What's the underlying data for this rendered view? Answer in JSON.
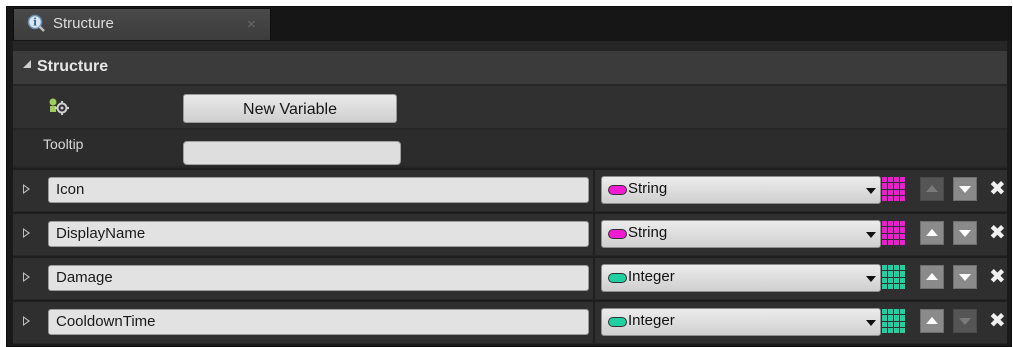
{
  "tab": {
    "title": "Structure",
    "icon": "search-info-icon",
    "close_glyph": "×"
  },
  "section": {
    "title": "Structure"
  },
  "new_variable_button": {
    "label": "New Variable",
    "icon": "add-variable-icon"
  },
  "tooltip": {
    "label": "Tooltip",
    "value": ""
  },
  "colors": {
    "string_pin": "#f219d3",
    "integer_pin": "#1fd1a0"
  },
  "variables": [
    {
      "name": "Icon",
      "type": "String",
      "pin_color": "#f219d3",
      "move_up_enabled": false,
      "move_down_enabled": true
    },
    {
      "name": "DisplayName",
      "type": "String",
      "pin_color": "#f219d3",
      "move_up_enabled": true,
      "move_down_enabled": true
    },
    {
      "name": "Damage",
      "type": "Integer",
      "pin_color": "#1fd1a0",
      "move_up_enabled": true,
      "move_down_enabled": true
    },
    {
      "name": "CooldownTime",
      "type": "Integer",
      "pin_color": "#1fd1a0",
      "move_up_enabled": true,
      "move_down_enabled": false
    }
  ],
  "remove_glyph": "✖"
}
